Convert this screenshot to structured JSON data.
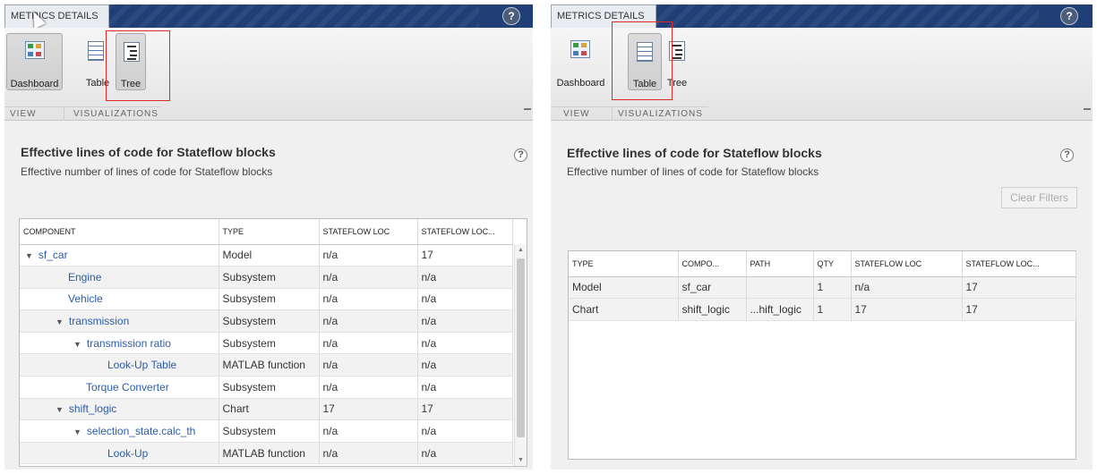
{
  "left": {
    "tab_label": "METRICS DETAILS",
    "help": "?",
    "toolstrip": {
      "dashboard": "Dashboard",
      "table": "Table",
      "tree": "Tree",
      "section_view": "VIEW",
      "section_visualizations": "VISUALIZATIONS"
    },
    "title": "Effective lines of code for Stateflow blocks",
    "subtitle": "Effective number of lines of code for Stateflow blocks",
    "q": "?",
    "columns": [
      "COMPONENT",
      "TYPE",
      "STATEFLOW LOC",
      "STATEFLOW LOC..."
    ],
    "rows": [
      {
        "component": "sf_car",
        "type": "Model",
        "loc": "n/a",
        "loc2": "17",
        "caret": "▼",
        "indent": 0
      },
      {
        "component": "Engine",
        "type": "Subsystem",
        "loc": "n/a",
        "loc2": "n/a",
        "caret": "",
        "indent": 1
      },
      {
        "component": "Vehicle",
        "type": "Subsystem",
        "loc": "n/a",
        "loc2": "n/a",
        "caret": "",
        "indent": 1
      },
      {
        "component": "transmission",
        "type": "Subsystem",
        "loc": "n/a",
        "loc2": "n/a",
        "caret": "▼",
        "indent": 1
      },
      {
        "component": "transmission ratio",
        "type": "Subsystem",
        "loc": "n/a",
        "loc2": "n/a",
        "caret": "▼",
        "indent": 2
      },
      {
        "component": "Look-Up Table",
        "type": "MATLAB function",
        "loc": "n/a",
        "loc2": "n/a",
        "caret": "",
        "indent": 3
      },
      {
        "component": "Torque Converter",
        "type": "Subsystem",
        "loc": "n/a",
        "loc2": "n/a",
        "caret": "",
        "indent": 2
      },
      {
        "component": "shift_logic",
        "type": "Chart",
        "loc": "17",
        "loc2": "17",
        "caret": "▼",
        "indent": 1
      },
      {
        "component": "selection_state.calc_th",
        "type": "Subsystem",
        "loc": "n/a",
        "loc2": "n/a",
        "caret": "▼",
        "indent": 2
      },
      {
        "component": "Look-Up",
        "type": "MATLAB function",
        "loc": "n/a",
        "loc2": "n/a",
        "caret": "",
        "indent": 3
      }
    ]
  },
  "right": {
    "tab_label": "METRICS DETAILS",
    "help": "?",
    "toolstrip": {
      "dashboard": "Dashboard",
      "table": "Table",
      "tree": "Tree",
      "section_view": "VIEW",
      "section_visualizations": "VISUALIZATIONS"
    },
    "title": "Effective lines of code for Stateflow blocks",
    "subtitle": "Effective number of lines of code for Stateflow blocks",
    "q": "?",
    "clear_filters": "Clear Filters",
    "columns": [
      "TYPE",
      "COMPO...",
      "PATH",
      "QTY",
      "STATEFLOW LOC",
      "STATEFLOW LOC..."
    ],
    "rows": [
      [
        "Model",
        "sf_car",
        "",
        "1",
        "n/a",
        "17"
      ],
      [
        "Chart",
        "shift_logic",
        "...hift_logic",
        "1",
        "17",
        "17"
      ]
    ]
  },
  "colors": {
    "title_bar": "#1f3f76",
    "link": "#2a5ca8",
    "highlight": "#e02828"
  }
}
